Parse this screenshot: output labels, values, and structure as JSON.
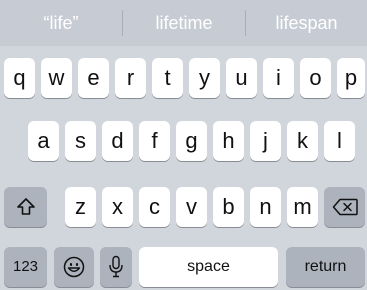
{
  "suggestions": [
    "“life”",
    "lifetime",
    "lifespan"
  ],
  "rows": {
    "row1": [
      "q",
      "w",
      "e",
      "r",
      "t",
      "y",
      "u",
      "i",
      "o",
      "p"
    ],
    "row2": [
      "a",
      "s",
      "d",
      "f",
      "g",
      "h",
      "j",
      "k",
      "l"
    ],
    "row3": [
      "z",
      "x",
      "c",
      "v",
      "b",
      "n",
      "m"
    ]
  },
  "bottom": {
    "numbers_label": "123",
    "space_label": "space",
    "return_label": "return"
  },
  "icons": {
    "shift": "shift-icon",
    "delete": "backspace-icon",
    "emoji": "emoji-icon",
    "mic": "microphone-icon"
  },
  "colors": {
    "keyboard_bg": "#d1d5dc",
    "suggestion_bar_bg": "#c7cbd3",
    "key_bg": "#ffffff",
    "special_key_bg": "#acb3bd"
  }
}
